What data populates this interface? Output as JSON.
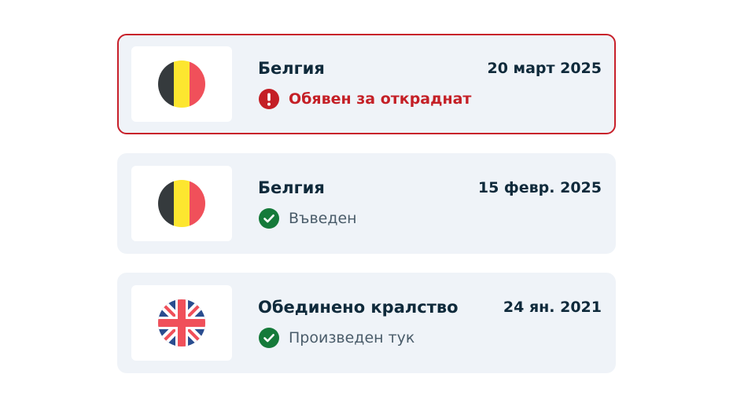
{
  "entries": [
    {
      "country": "Белгия",
      "date": "20 март 2025",
      "status": "Обявен за откраднат",
      "status_icon": "exclamation-circle-icon",
      "flag_icon": "belgium-flag-icon",
      "state": "alert"
    },
    {
      "country": "Белгия",
      "date": "15 февр. 2025",
      "status": "Въведен",
      "status_icon": "check-circle-icon",
      "flag_icon": "belgium-flag-icon",
      "state": "ok"
    },
    {
      "country": "Обединено кралство",
      "date": "24 ян. 2021",
      "status": "Произведен тук",
      "status_icon": "check-circle-icon",
      "flag_icon": "uk-flag-icon",
      "state": "ok"
    }
  ],
  "colors": {
    "card_background": "#eff3f8",
    "alert_border": "#c8202a",
    "alert_text": "#c41f26",
    "success_green": "#157a3a",
    "heading_text": "#0f2a3b",
    "secondary_text": "#4a5c6a"
  }
}
